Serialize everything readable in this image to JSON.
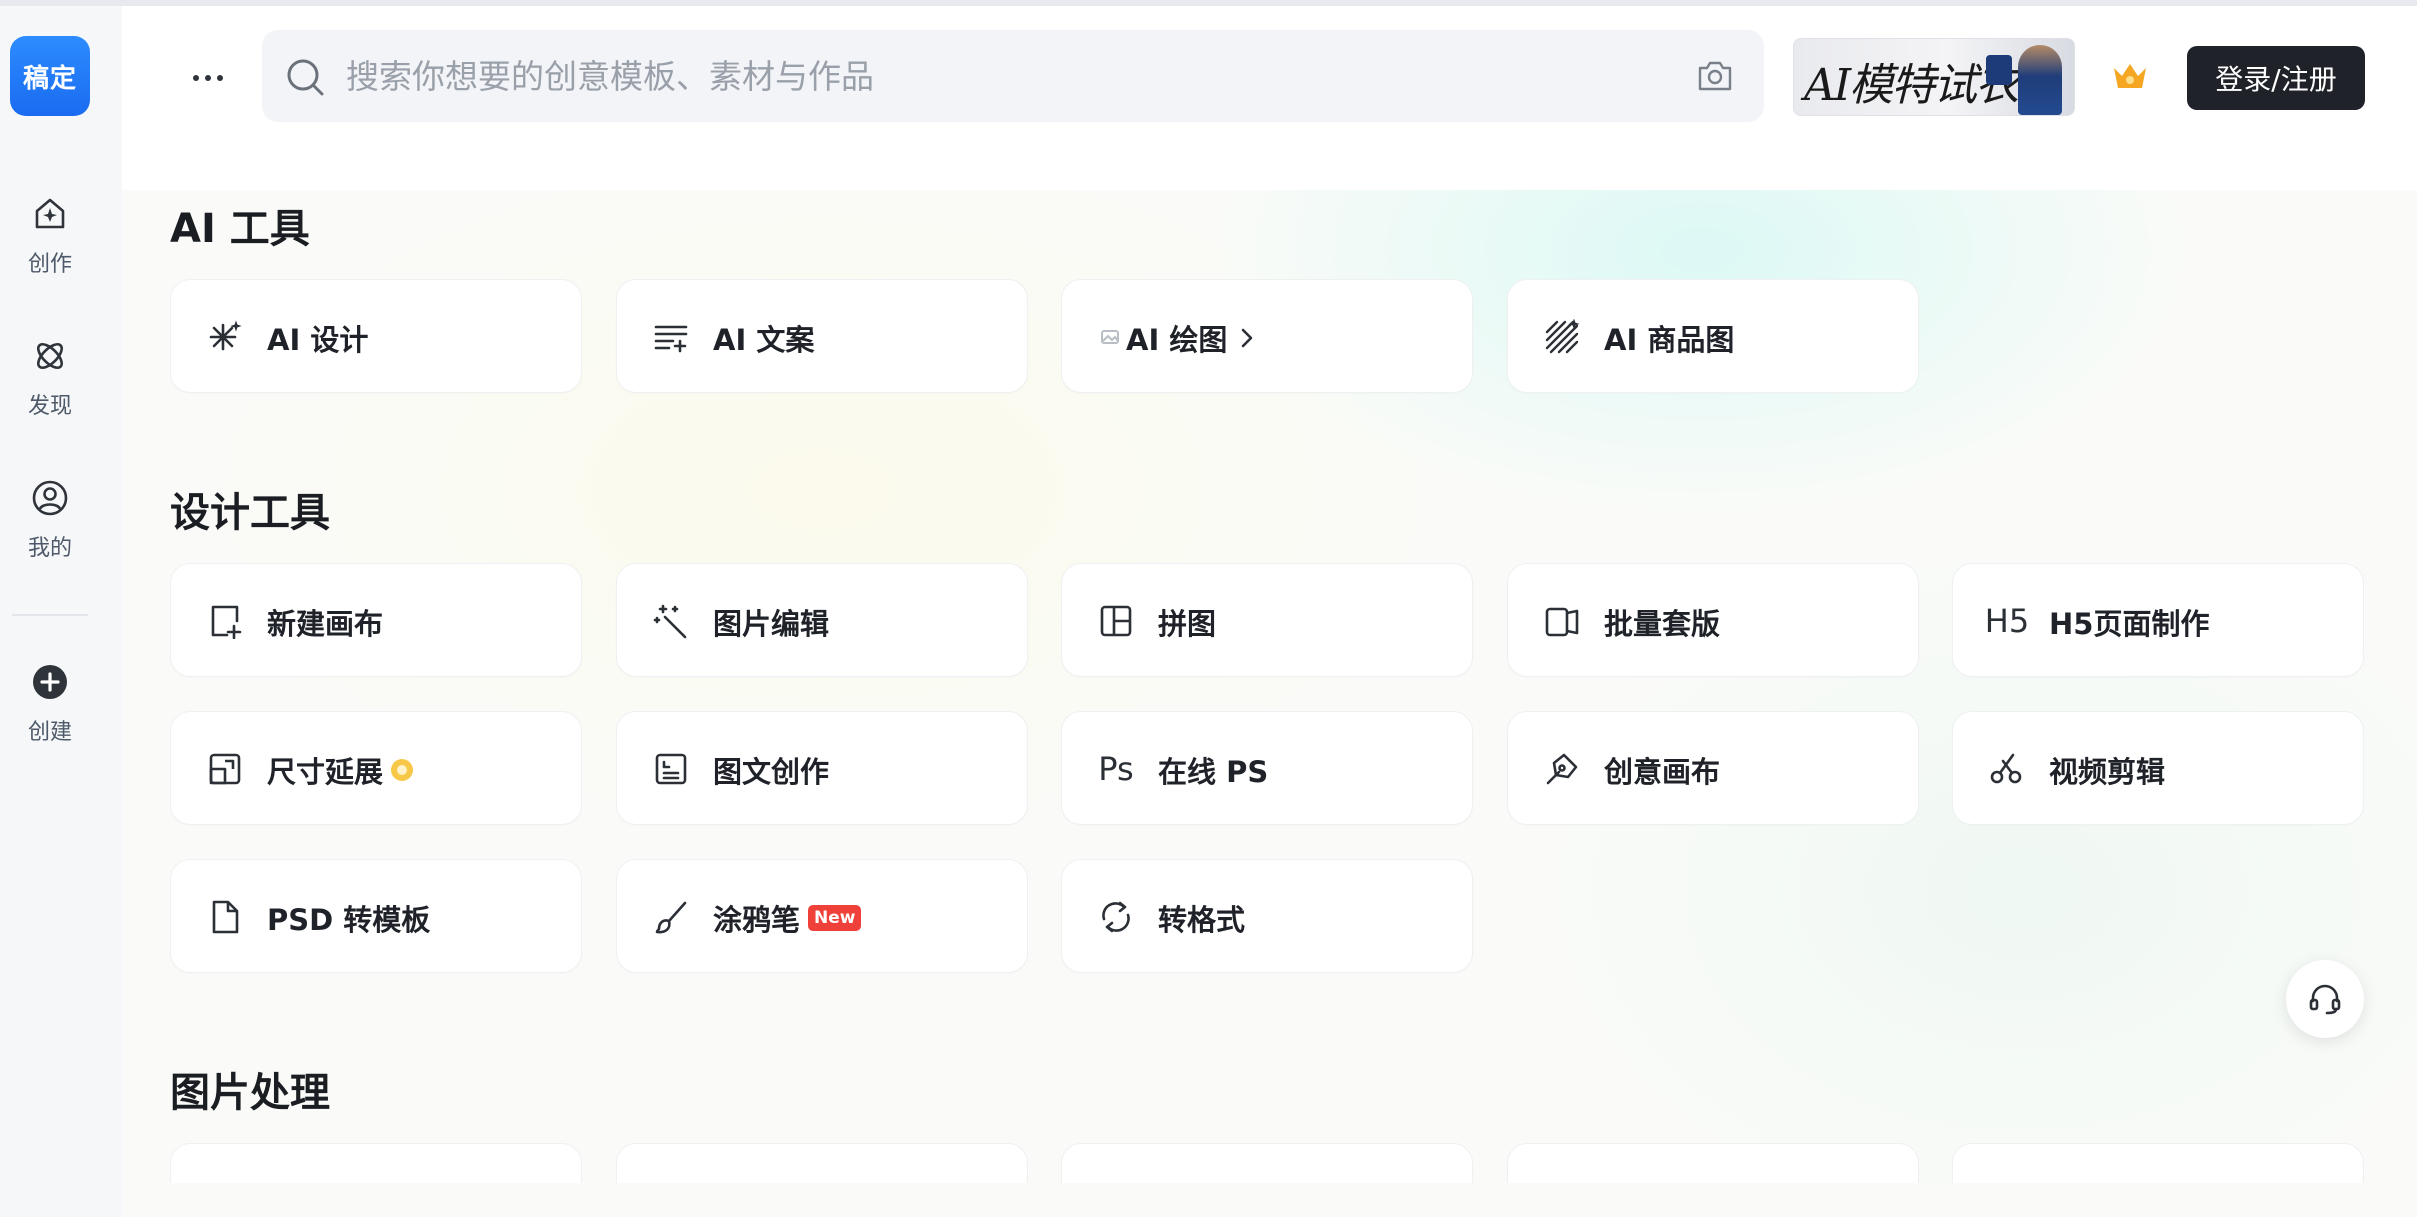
{
  "brand": {
    "logo_text": "稿定",
    "accent": "#1a6bf0"
  },
  "sidebar": {
    "items": [
      {
        "label": "创作",
        "icon": "home-create-icon"
      },
      {
        "label": "发现",
        "icon": "orbit-discover-icon"
      },
      {
        "label": "我的",
        "icon": "user-icon"
      },
      {
        "label": "创建",
        "icon": "plus-circle-icon"
      }
    ]
  },
  "topbar": {
    "search_placeholder": "搜索你想要的创意模板、素材与作品",
    "banner_text": "AI模特试衣",
    "login_label": "登录/注册"
  },
  "sections": {
    "ai_tools": {
      "title": "AI 工具",
      "items": [
        {
          "label": "AI 设计",
          "icon": "sparkle-icon"
        },
        {
          "label": "AI 文案",
          "icon": "text-lines-icon"
        },
        {
          "label": "AI 绘图",
          "icon": "image-icon"
        },
        {
          "label": "AI 商品图",
          "icon": "hatch-sparkle-icon"
        }
      ]
    },
    "design_tools": {
      "title": "设计工具",
      "items": [
        {
          "label": "新建画布",
          "icon": "new-canvas-icon"
        },
        {
          "label": "图片编辑",
          "icon": "magic-wand-icon"
        },
        {
          "label": "拼图",
          "icon": "collage-icon"
        },
        {
          "label": "批量套版",
          "icon": "batch-icon"
        },
        {
          "label": "H5页面制作",
          "icon": "h5-icon",
          "icon_text": "H5"
        },
        {
          "label": "尺寸延展",
          "icon": "resize-icon"
        },
        {
          "label": "图文创作",
          "icon": "article-icon"
        },
        {
          "label": "在线 PS",
          "icon": "ps-icon",
          "icon_text": "Ps"
        },
        {
          "label": "创意画布",
          "icon": "pen-nib-icon"
        },
        {
          "label": "视频剪辑",
          "icon": "scissors-icon"
        },
        {
          "label": "PSD 转模板",
          "icon": "file-icon"
        },
        {
          "label": "涂鸦笔",
          "icon": "brush-icon",
          "badge": "New"
        },
        {
          "label": "转格式",
          "icon": "convert-icon"
        }
      ]
    },
    "image_processing": {
      "title": "图片处理"
    }
  }
}
